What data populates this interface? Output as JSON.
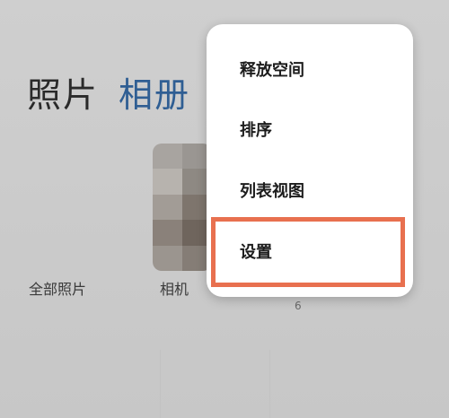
{
  "tabs": {
    "photos": "照片",
    "albums": "相册"
  },
  "albums": [
    {
      "label": "全部照片"
    },
    {
      "label": "相机"
    }
  ],
  "album_count": "6",
  "menu": {
    "items": [
      {
        "label": "释放空间"
      },
      {
        "label": "排序"
      },
      {
        "label": "列表视图"
      },
      {
        "label": "设置"
      }
    ]
  },
  "colors": {
    "active_tab": "#2f5e93",
    "highlight_border": "#e8704f",
    "menu_background": "#ffffff"
  }
}
